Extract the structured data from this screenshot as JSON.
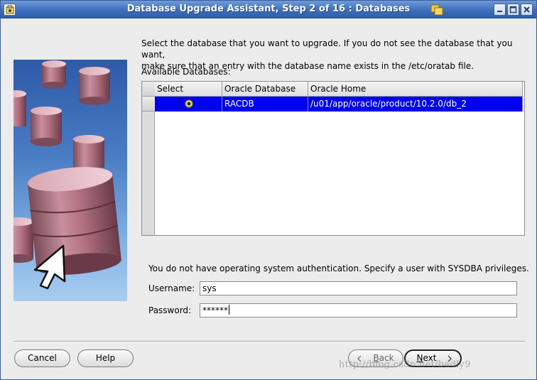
{
  "window": {
    "title": "Database Upgrade Assistant, Step 2 of 16 : Databases"
  },
  "instruction": {
    "line1": "Select the database that you want to upgrade. If you do not see the database that you want,",
    "line2": "make sure that an entry with the database name exists in the /etc/oratab file."
  },
  "databases": {
    "label": "Available Databases:",
    "columns": [
      "Select",
      "Oracle Database",
      "Oracle Home"
    ],
    "rows": [
      {
        "selected": true,
        "database": "RACDB",
        "home": "/u01/app/oracle/product/10.2.0/db_2"
      }
    ]
  },
  "auth": {
    "message": "You do not have operating system authentication. Specify a user with SYSDBA privileges.",
    "username_label": "Username:",
    "username_value": "sys",
    "password_label": "Password:",
    "password_value": "******"
  },
  "buttons": {
    "cancel": "Cancel",
    "help": "Help",
    "back_pre": "",
    "back_mn": "B",
    "back_post": "ack",
    "next_pre": "",
    "next_mn": "N",
    "next_post": "ext"
  },
  "watermark": "http://blog.csdn.net/badly9",
  "colors": {
    "selection": "#0000ee",
    "titlebar": "#3f6fbd"
  }
}
